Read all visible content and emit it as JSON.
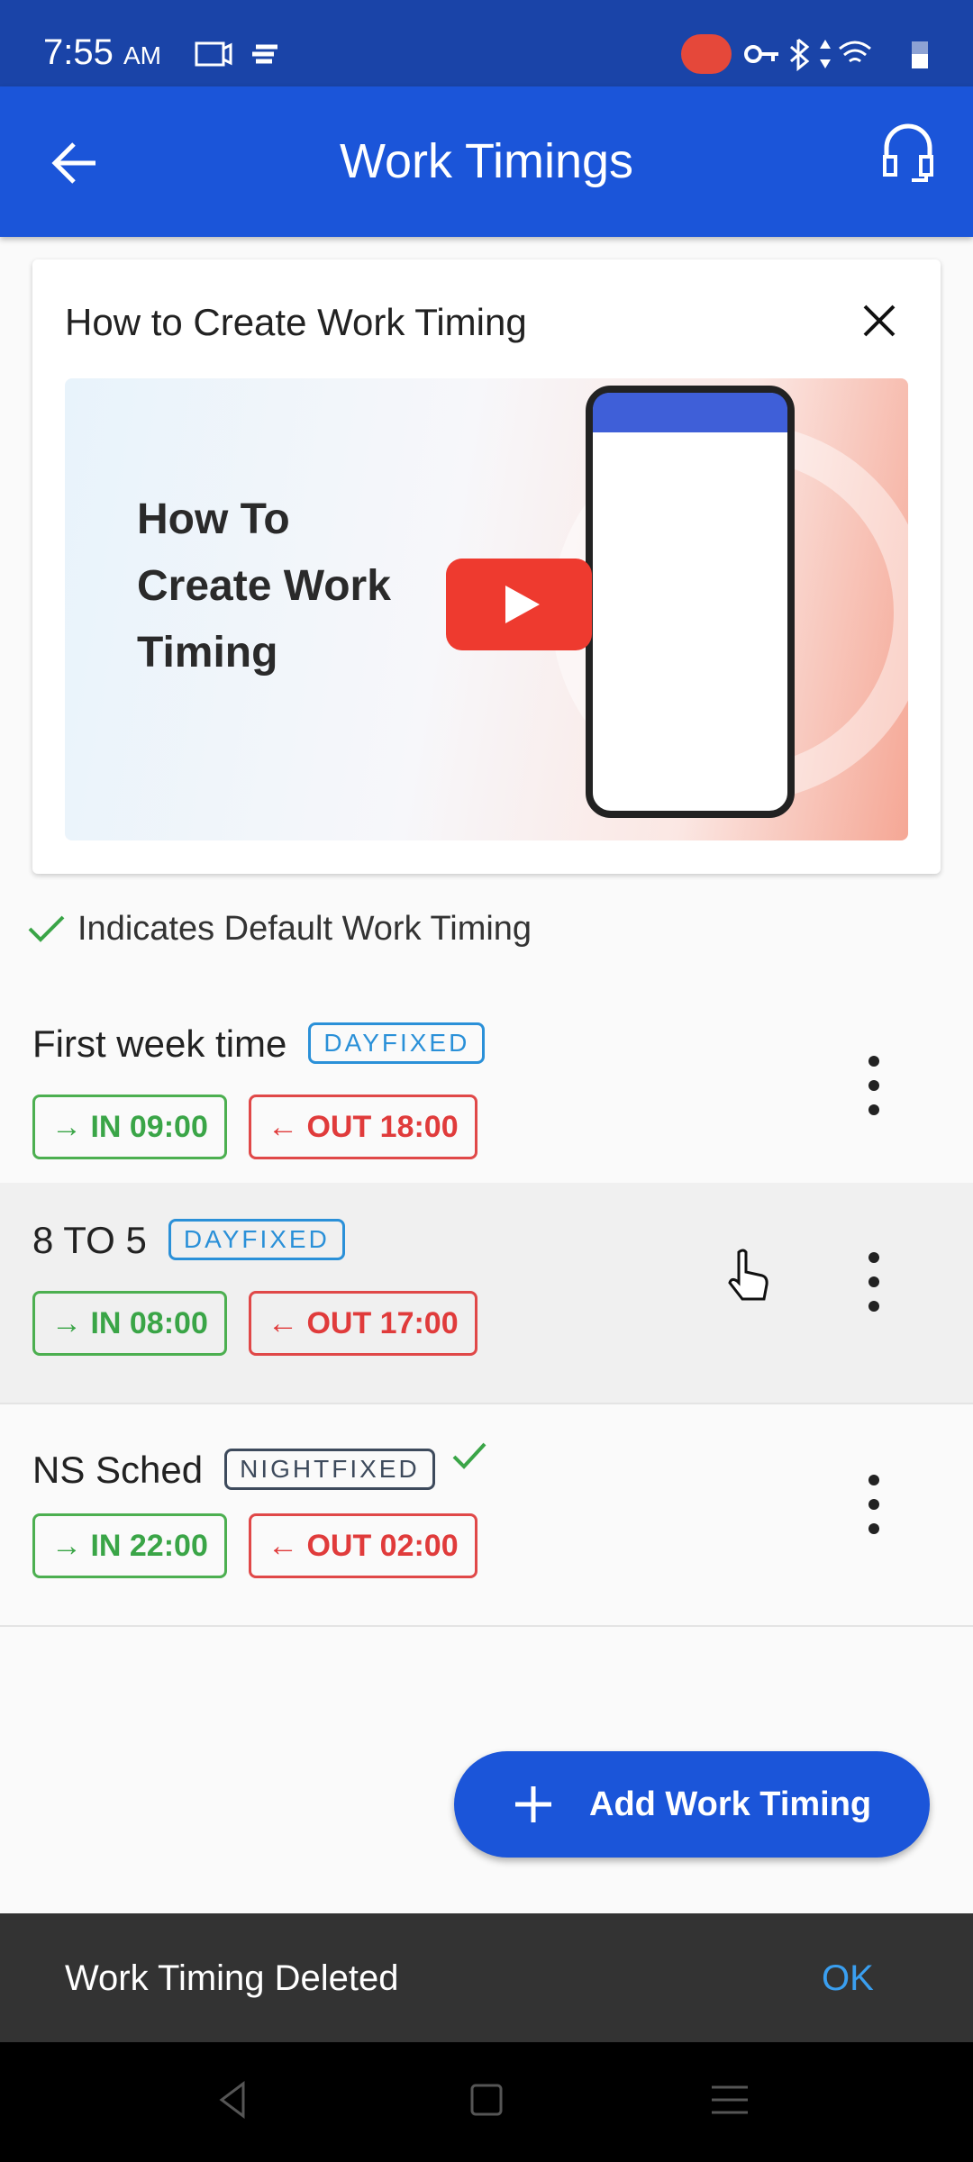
{
  "status_bar": {
    "time": "7:55",
    "ampm": "AM"
  },
  "app_bar": {
    "title": "Work Timings",
    "back_icon": "arrow-left-icon",
    "support_icon": "headset-icon"
  },
  "video_card": {
    "title": "How to Create Work Timing",
    "thumbnail_text": [
      "How To",
      "Create Work",
      "Timing"
    ]
  },
  "legend": "Indicates Default Work Timing",
  "timings": [
    {
      "name": "First week time",
      "type": "DAYFIXED",
      "in": "IN 09:00",
      "out": "OUT 18:00",
      "default": false
    },
    {
      "name": "8 TO 5",
      "type": "DAYFIXED",
      "in": "IN 08:00",
      "out": "OUT 17:00",
      "default": false
    },
    {
      "name": "NS Sched",
      "type": "NIGHTFIXED",
      "in": "IN 22:00",
      "out": "OUT 02:00",
      "default": true
    }
  ],
  "fab_label": "Add Work Timing",
  "snackbar": {
    "message": "Work Timing Deleted",
    "action": "OK"
  },
  "colors": {
    "primary": "#1b55d9",
    "in": "#3aa547",
    "out": "#e03b3b",
    "dayfixed": "#2a90d8",
    "nightfixed": "#3d4a5c"
  }
}
